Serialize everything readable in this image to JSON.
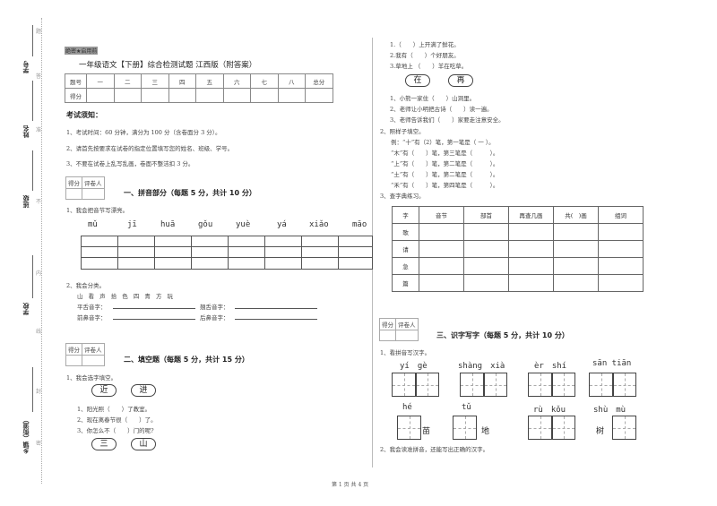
{
  "binding": {
    "labels": [
      "学号",
      "姓名",
      "班级",
      "学校",
      "乡镇（街道）"
    ],
    "seal_chars": [
      "题",
      "答",
      "准",
      "不",
      "内",
      "线",
      "封",
      "密"
    ]
  },
  "header": {
    "secret_label": "绝密★启用前",
    "title": "一年级语文【下册】综合检测试题 江西版（附答案）"
  },
  "score_table": {
    "row1": [
      "题号",
      "一",
      "二",
      "三",
      "四",
      "五",
      "六",
      "七",
      "八",
      "总分"
    ],
    "row2_label": "得分"
  },
  "notice": {
    "title": "考试须知：",
    "items": [
      "1、考试时间：60 分钟，满分为 100 分（含卷面分 3 分）。",
      "2、请首先按要求在试卷的指定位置填写您的姓名、班级、学号。",
      "3、不要在试卷上乱写乱画，卷面不整洁扣 3 分。"
    ]
  },
  "grader": {
    "score": "得分",
    "reviewer": "评卷人"
  },
  "section1": {
    "title": "一、拼音部分（每题 5 分，共计 10 分）",
    "q1": "1、我会把音节写漂亮。",
    "pinyin": [
      "mǔ",
      "jī",
      "huā",
      "gǒu",
      "yuè",
      "yá",
      "xiǎo",
      "māo"
    ],
    "q2": "2、我会分类。",
    "chars": "山 看 声 拾 色 四 青 方 玩",
    "labels": [
      "平舌音字：",
      "翘舌音字：",
      "前鼻音字：",
      "后鼻音字："
    ]
  },
  "section2": {
    "title": "二、填空题（每题 5 分，共计 15 分）",
    "q1": "1、我会选字填空。",
    "group1_options": [
      "近",
      "进"
    ],
    "group1_items": [
      "1、阳光照（　　）了教室。",
      "2、现在离春节很（　　）了。",
      "3、你怎么不（　　）门的呢?"
    ],
    "group2_options": [
      "三",
      "山"
    ],
    "group2_items": [
      "1.（　　）上开满了鲜花。",
      "2.我有（　　）个好朋友。",
      "3.草地上 （　　）羊在吃草。"
    ],
    "group3_options": [
      "在",
      "再"
    ],
    "group3_items": [
      "1、小熊一家住（　　）山洞里。",
      "2、老师让小明把古诗（　　）读一遍。",
      "3、老师告诉我们（　　）家要走注意安全。"
    ],
    "q2": "2、照样子填空。",
    "q2_items": [
      "例：“十”有（2）笔，第一笔是（ 一 ）。",
      "“木”有（　　）笔，第三笔是（　　　）。",
      "“上”有（　　）笔，第二笔是（　　　）。",
      "“土”有（　　）笔，第二笔是（　　　）。",
      "“禾”有（　　）笔，第四笔是（　　　）。"
    ],
    "q3": "3、查字典练习。",
    "dict_headers": [
      "字",
      "音节",
      "部首",
      "再查几画",
      "共(　)画",
      "组词"
    ],
    "dict_chars": [
      "歌",
      "请",
      "急",
      "篇"
    ]
  },
  "section3": {
    "title": "三、识字写字（每题 5 分，共计 10 分）",
    "q1": "1、看拼音写汉字。",
    "row1": [
      {
        "pinyin": "yí　gè"
      },
      {
        "pinyin": "shàng　xià"
      },
      {
        "pinyin": "èr　shí"
      },
      {
        "pinyin": "sān tiān"
      }
    ],
    "row2": [
      {
        "pinyin": "hé",
        "after": "苗"
      },
      {
        "pinyin": "tǔ",
        "after": "地"
      },
      {
        "pinyin": "rù　kǒu"
      },
      {
        "pinyin": "shù　mù",
        "before": "树"
      }
    ],
    "q2": "2、我会读准拼音，还能写出正确的汉字。"
  },
  "footer": {
    "page": "第 1 页 共 4 页"
  }
}
